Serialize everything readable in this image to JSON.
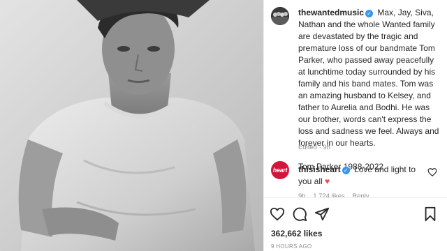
{
  "post": {
    "author": {
      "username": "thewantedmusic",
      "verified_icon": "verified-badge-icon"
    },
    "caption": "Max, Jay, Siva, Nathan and the whole Wanted family are devastated by the tragic and premature loss of our bandmate Tom Parker, who passed away peacefully at lunchtime today surrounded by his family and his band mates. Tom was an amazing husband to Kelsey, and father to Aurelia and Bodhi. He was our brother, words can't express the loss and sadness we feel. Always and forever in our hearts.",
    "caption_signature": "Tom Parker 1988-2022",
    "edited_meta": "Edited · 9h",
    "likes": "362,662 likes",
    "time_ago": "9 HOURS AGO"
  },
  "comment": {
    "avatar_text": "heart",
    "username": "thisisheart",
    "text": "Love and light to you all",
    "emoji": "♥",
    "time": "9h",
    "likes": "1,724 likes",
    "reply": "Reply"
  },
  "icons": {
    "like": "heart-outline-icon",
    "comment": "speech-bubble-icon",
    "share": "paper-plane-icon",
    "save": "bookmark-icon",
    "comment_like": "small-heart-outline-icon"
  },
  "colors": {
    "verified": "#3897f0",
    "heart_brand": "#d4153a",
    "emoji_heart": "#ed4956",
    "meta_text": "#8e8e8e"
  }
}
